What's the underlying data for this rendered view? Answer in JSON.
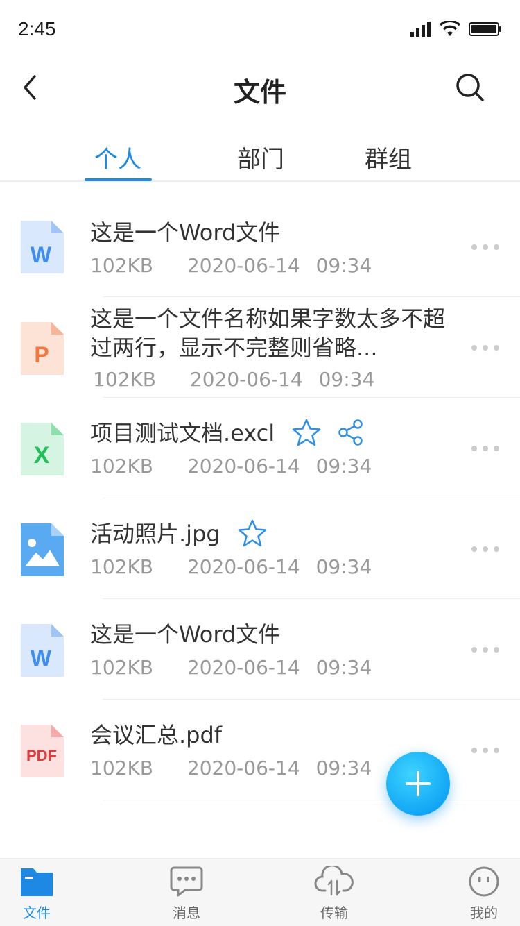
{
  "status": {
    "time": "2:45"
  },
  "nav": {
    "title": "文件"
  },
  "tabs": [
    {
      "label": "个人",
      "active": true
    },
    {
      "label": "部门",
      "active": false
    },
    {
      "label": "群组",
      "active": false
    }
  ],
  "files": [
    {
      "icon": "word-file-icon",
      "badge": "W",
      "name": "这是一个Word文件",
      "size": "102KB",
      "date": "2020-06-14",
      "time": "09:34",
      "starred": false,
      "shared": false
    },
    {
      "icon": "ppt-file-icon",
      "badge": "P",
      "name": "这是一个文件名称如果字数太多不超过两行，显示不完整则省略...",
      "size": "102KB",
      "date": "2020-06-14",
      "time": "09:34",
      "starred": false,
      "shared": false
    },
    {
      "icon": "excel-file-icon",
      "badge": "X",
      "name": "项目测试文档.excl",
      "size": "102KB",
      "date": "2020-06-14",
      "time": "09:34",
      "starred": true,
      "shared": true
    },
    {
      "icon": "image-file-icon",
      "badge": "",
      "name": "活动照片.jpg",
      "size": "102KB",
      "date": "2020-06-14",
      "time": "09:34",
      "starred": true,
      "shared": false
    },
    {
      "icon": "word-file-icon",
      "badge": "W",
      "name": "这是一个Word文件",
      "size": "102KB",
      "date": "2020-06-14",
      "time": "09:34",
      "starred": false,
      "shared": false
    },
    {
      "icon": "pdf-file-icon",
      "badge": "PDF",
      "name": "会议汇总.pdf",
      "size": "102KB",
      "date": "2020-06-14",
      "time": "09:34",
      "starred": false,
      "shared": false
    }
  ],
  "bottom_tabs": [
    {
      "label": "文件",
      "icon": "folder-icon",
      "active": true
    },
    {
      "label": "消息",
      "icon": "message-icon",
      "active": false
    },
    {
      "label": "传输",
      "icon": "cloud-transfer-icon",
      "active": false
    },
    {
      "label": "我的",
      "icon": "profile-icon",
      "active": false
    }
  ],
  "colors": {
    "accent": "#1e88e5",
    "word": "#3d8ef0",
    "ppt": "#f4763a",
    "excel": "#1fbf5a",
    "image": "#5aaaf2",
    "pdf": "#e23a3a",
    "fab": "#11a7f5"
  }
}
